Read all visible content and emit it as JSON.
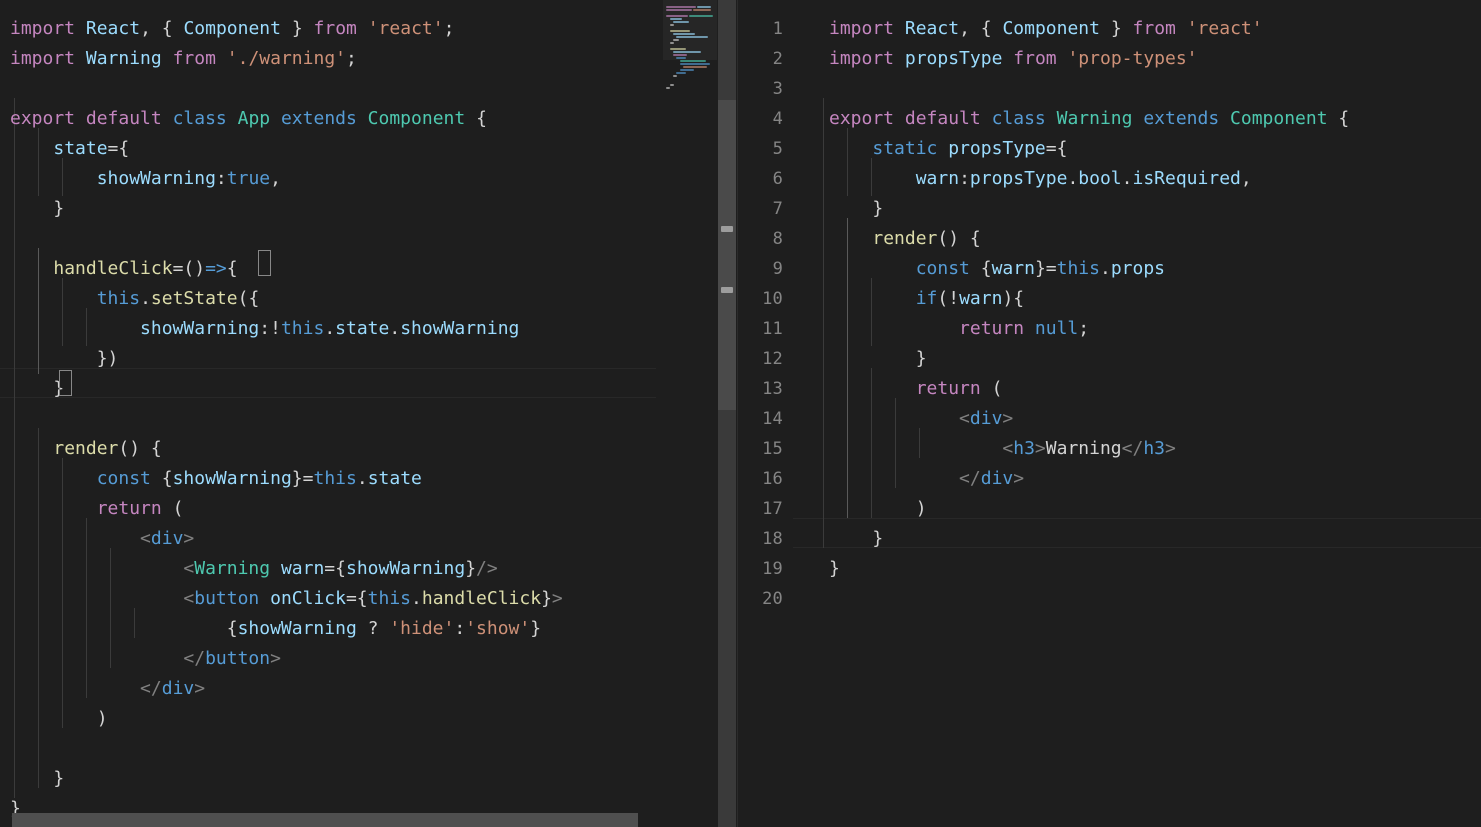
{
  "app": {
    "kind": "code-editor",
    "theme": "dark-plus",
    "background": "#1e1e1e",
    "font_size_px": 18,
    "line_height_px": 30
  },
  "colors": {
    "background": "#1e1e1e",
    "keyword": "#c586c0",
    "control": "#569cd6",
    "variable": "#9cdcfe",
    "type": "#4ec9b0",
    "function": "#dcdcaa",
    "string": "#ce9178",
    "plain": "#d4d4d4",
    "line_number": "#858585",
    "indent_guide": "#3b3b3b",
    "current_line_border": "#282828",
    "scrollbar_track": "#3a3a3a",
    "scrollbar_thumb": "#4a4a4a",
    "bracket_match_border": "#888888"
  },
  "panes": [
    {
      "id": "left",
      "name": "app-editor-pane",
      "shows_line_numbers": false,
      "has_minimap": true,
      "has_vertical_scrollbar": true,
      "has_horizontal_scrollbar": true,
      "current_line_index": 12,
      "lines": [
        "import React, { Component } from 'react';",
        "import Warning from './warning';",
        "",
        "export default class App extends Component {",
        "    state={",
        "        showWarning:true,",
        "    }",
        "",
        "    handleClick=()=>{",
        "        this.setState({",
        "            showWarning:!this.state.showWarning",
        "        })",
        "    }",
        "",
        "    render() {",
        "        const {showWarning}=this.state",
        "        return (",
        "            <div>",
        "                <Warning warn={showWarning}/>",
        "                <button onClick={this.handleClick}>",
        "                    {showWarning ? 'hide':'show'}",
        "                </button>",
        "            </div>",
        "        )",
        "",
        "",
        "    }",
        "}"
      ]
    },
    {
      "id": "right",
      "name": "warning-editor-pane",
      "shows_line_numbers": true,
      "has_minimap": false,
      "has_vertical_scrollbar": false,
      "has_horizontal_scrollbar": false,
      "current_line_index": 17,
      "line_numbers": [
        "1",
        "2",
        "3",
        "4",
        "5",
        "6",
        "7",
        "8",
        "9",
        "10",
        "11",
        "12",
        "13",
        "14",
        "15",
        "16",
        "17",
        "18",
        "19",
        "20"
      ],
      "lines": [
        "import React, { Component } from 'react'",
        "import propsType from 'prop-types'",
        "",
        "export default class Warning extends Component {",
        "    static propsType={",
        "        warn:propsType.bool.isRequired,",
        "    }",
        "    render() {",
        "        const {warn}=this.props",
        "        if(!warn){",
        "            return null;",
        "        }",
        "        return (",
        "            <div>",
        "                <h3>Warning</h3>",
        "            </div>",
        "        )",
        "    }",
        "}",
        ""
      ]
    }
  ]
}
